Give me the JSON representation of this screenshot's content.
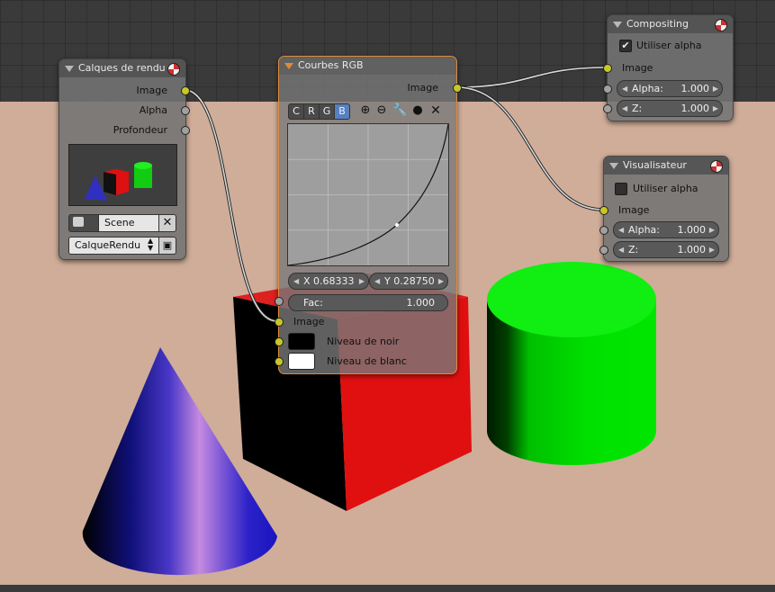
{
  "nodes": {
    "render_layers": {
      "title": "Calques de rendu",
      "outputs": [
        "Image",
        "Alpha",
        "Profondeur"
      ],
      "scene_label": "Scene",
      "layer_label": "CalqueRendu"
    },
    "rgb_curves": {
      "title": "Courbes RGB",
      "output": "Image",
      "channels": [
        "C",
        "R",
        "G",
        "B"
      ],
      "active_channel": "B",
      "x_label": "X 0.68333",
      "y_label": "Y 0.28750",
      "fac_label": "Fac:",
      "fac_value": "1.000",
      "inputs": [
        "Image",
        "Niveau de noir",
        "Niveau de blanc"
      ],
      "black_color": "#000000",
      "white_color": "#ffffff"
    },
    "composite": {
      "title": "Compositing",
      "use_alpha_label": "Utiliser alpha",
      "use_alpha_checked": true,
      "input": "Image",
      "alpha_label": "Alpha:",
      "alpha_value": "1.000",
      "z_label": "Z:",
      "z_value": "1.000"
    },
    "viewer": {
      "title": "Visualisateur",
      "use_alpha_label": "Utiliser alpha",
      "use_alpha_checked": false,
      "input": "Image",
      "alpha_label": "Alpha:",
      "alpha_value": "1.000",
      "z_label": "Z:",
      "z_value": "1.000"
    }
  },
  "colors": {
    "active_node_border": "#e08a3c",
    "color_socket": "#c7c729",
    "value_socket": "#a1a1a1",
    "active_channel": "#5680c2"
  }
}
